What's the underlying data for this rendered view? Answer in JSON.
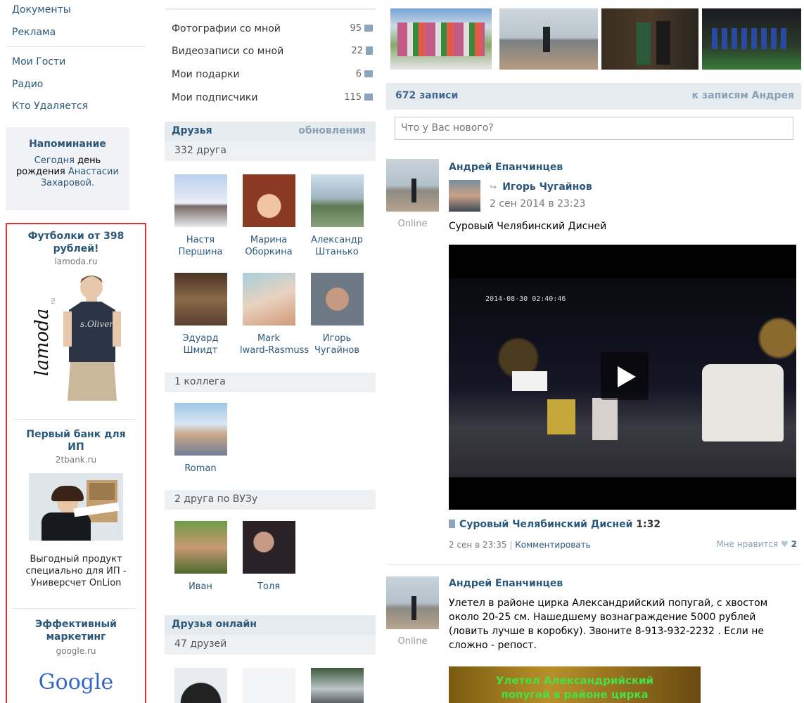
{
  "left_nav": {
    "items_top": [
      "Документы",
      "Реклама"
    ],
    "items_bottom": [
      "Мои Гости",
      "Радио",
      "Кто Удаляется"
    ]
  },
  "reminder": {
    "title": "Напоминание",
    "line1_a": "Сегодня",
    "line1_b": "день",
    "line2_a": "рождения",
    "line2_b": "Анастасии",
    "line3": "Захаровой."
  },
  "ads": [
    {
      "title": "Футболки от 398 рублей!",
      "domain": "lamoda.ru",
      "brand": "lamoda",
      "brand_sup": "ru",
      "shirt_text": "s.Oliver"
    },
    {
      "title": "Первый банк для ИП",
      "domain": "2tbank.ru",
      "desc": "Выгодный продукт специально для ИП - Универсчет OnLion"
    },
    {
      "title": "Эффективный маркетинг",
      "domain": "google.ru",
      "brand": "Google"
    }
  ],
  "stats": [
    {
      "label": "Фотографии со мной",
      "count": "95",
      "icon": "camera-icon"
    },
    {
      "label": "Видеозаписи со мной",
      "count": "22",
      "icon": "film-icon"
    },
    {
      "label": "Мои подарки",
      "count": "6",
      "icon": "gift-icon"
    },
    {
      "label": "Мои подписчики",
      "count": "115",
      "icon": "followers-icon"
    }
  ],
  "friends": {
    "title": "Друзья",
    "updates": "обновления",
    "count": "332 друга",
    "list": [
      {
        "first": "Настя",
        "last": "Першина"
      },
      {
        "first": "Марина",
        "last": "Оборкина"
      },
      {
        "first": "Александр",
        "last": "Штанько"
      },
      {
        "first": "Эдуард",
        "last": "Шмидт"
      },
      {
        "first": "Mark",
        "last": "lward-Rasmuss"
      },
      {
        "first": "Игорь",
        "last": "Чугайнов"
      }
    ],
    "colleagues_count": "1 коллега",
    "colleagues": [
      {
        "name": "Roman"
      }
    ],
    "uni_count": "2 друга по ВУЗу",
    "uni": [
      {
        "name": "Иван"
      },
      {
        "name": "Толя"
      }
    ],
    "online_title": "Друзья онлайн",
    "online_count": "47 друзей"
  },
  "wall": {
    "count": "672 записи",
    "to_link": "к записям Андрея",
    "placeholder": "Что у Вас нового?",
    "post1": {
      "author": "Андрей Епанчинцев",
      "online": "Online",
      "repost_author": "Игорь Чугайнов",
      "repost_date": "2 сен 2014 в 23:23",
      "text": "Суровый Челябинский Дисней",
      "video_stamp": "2014-08-30 02:40:46",
      "video_title": "Суровый Челябинский Дисней",
      "video_duration": "1:32",
      "date": "2 сен в 23:35",
      "comment": "Комментировать",
      "like_label": "Мне нравится",
      "like_count": "2"
    },
    "post2": {
      "author": "Андрей Епанчинцев",
      "online": "Online",
      "text": "Улетел в районе цирка Александрийский попугай, с хвостом около 20-25 см. Нашедшему вознаграждение 5000 рублей (ловить лучше в коробку). Звоните 8-913-932-2232 . Если не сложно - репост.",
      "image_text_1": "Улетел Александрийский",
      "image_text_2": "попугай в районе цирка"
    }
  },
  "colors": {
    "link": "#2b587a",
    "header_bg": "#e6ebf0",
    "ad_border": "#dd3333"
  }
}
